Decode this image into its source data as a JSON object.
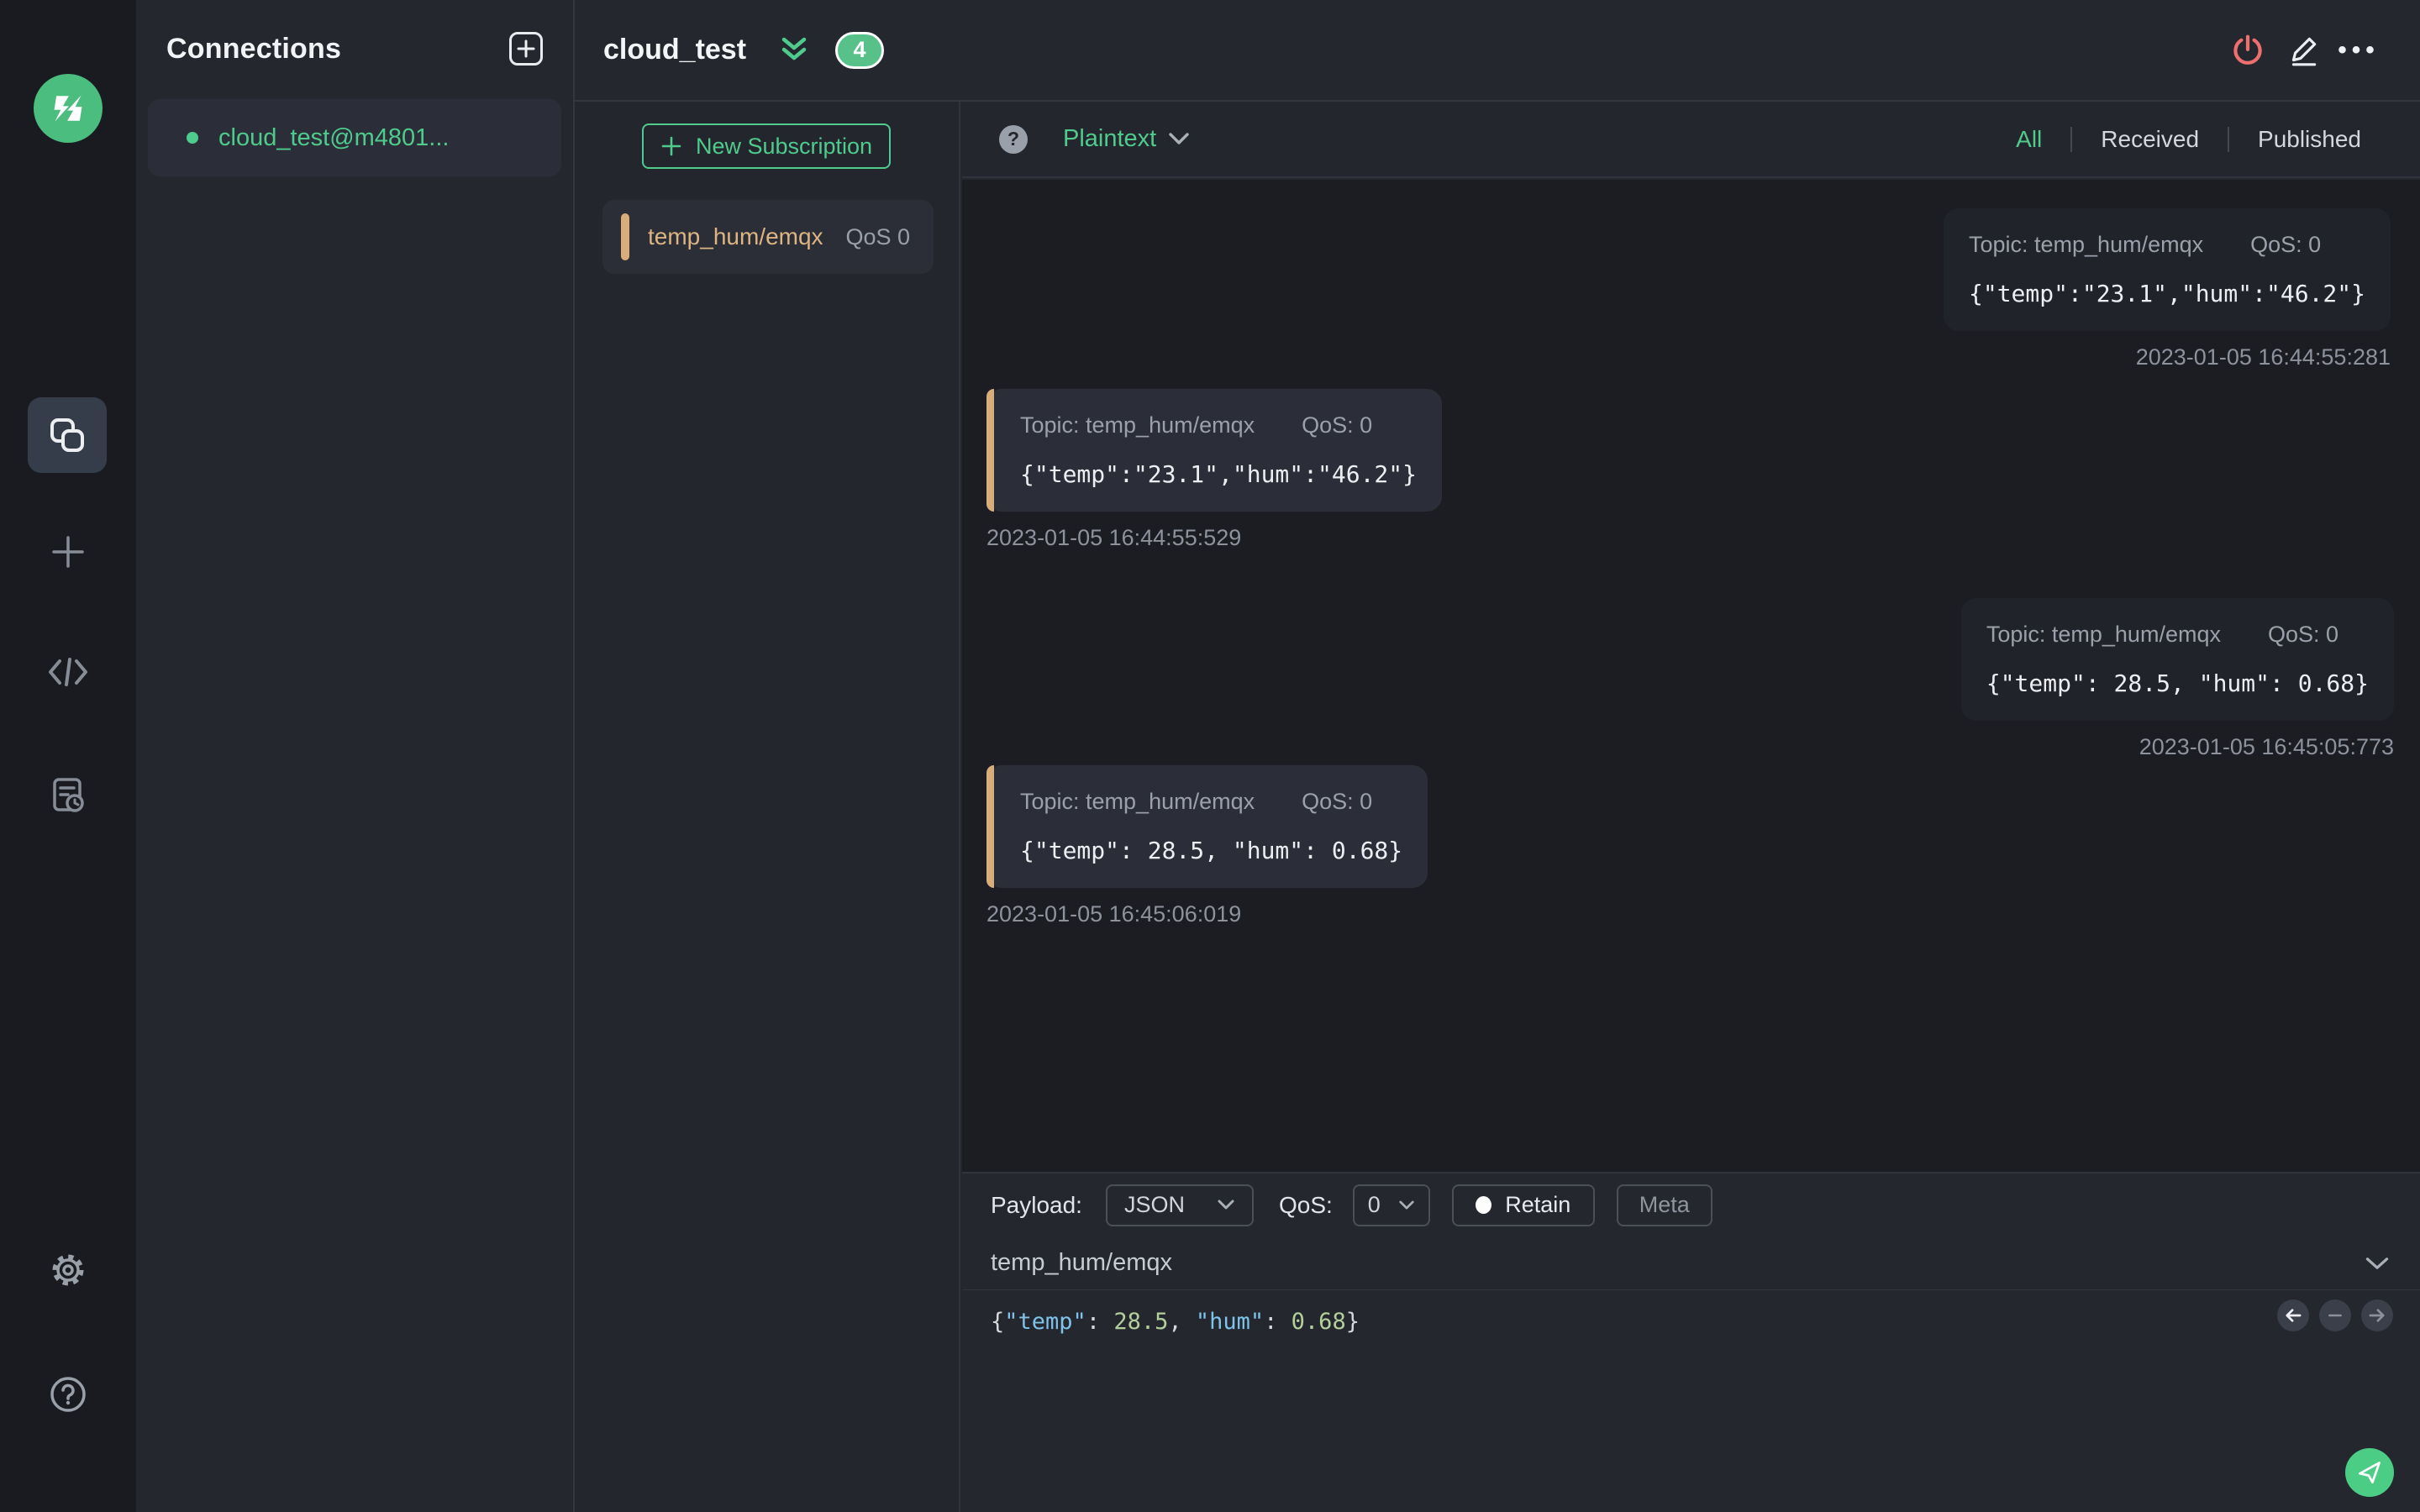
{
  "colors": {
    "accent_green": "#4ecb8d",
    "danger_red": "#ee6f6f",
    "topic_tan": "#d8ad79",
    "syntax_key_blue": "#7ec3ea",
    "syntax_num_green": "#b3cf9b"
  },
  "connections_panel": {
    "title": "Connections",
    "items": [
      {
        "name": "cloud_test@m4801..."
      }
    ]
  },
  "header": {
    "title": "cloud_test",
    "badge": "4"
  },
  "subscriptions": {
    "new_label": "New Subscription",
    "items": [
      {
        "topic": "temp_hum/emqx",
        "qos": "QoS 0"
      }
    ]
  },
  "toolbar": {
    "format_label": "Plaintext",
    "tabs": [
      "All",
      "Received",
      "Published"
    ]
  },
  "messages": [
    {
      "direction": "published",
      "topic_label": "Topic: temp_hum/emqx",
      "qos_label": "QoS: 0",
      "payload": "{\"temp\":\"23.1\",\"hum\":\"46.2\"}",
      "time": "2023-01-05 16:44:55:281"
    },
    {
      "direction": "received",
      "topic_label": "Topic: temp_hum/emqx",
      "qos_label": "QoS: 0",
      "payload": "{\"temp\":\"23.1\",\"hum\":\"46.2\"}",
      "time": "2023-01-05 16:44:55:529"
    },
    {
      "direction": "published",
      "topic_label": "Topic: temp_hum/emqx",
      "qos_label": "QoS: 0",
      "payload": "{\"temp\": 28.5, \"hum\": 0.68}",
      "time": "2023-01-05 16:45:05:773"
    },
    {
      "direction": "received",
      "topic_label": "Topic: temp_hum/emqx",
      "qos_label": "QoS: 0",
      "payload": "{\"temp\": 28.5, \"hum\": 0.68}",
      "time": "2023-01-05 16:45:06:019"
    }
  ],
  "publish": {
    "payload_label": "Payload:",
    "format_value": "JSON",
    "qos_label": "QoS:",
    "qos_value": "0",
    "retain_label": "Retain",
    "meta_label": "Meta",
    "topic_value": "temp_hum/emqx",
    "tokens": [
      {
        "text": "{"
      },
      {
        "text": "\"temp\""
      },
      {
        "text": ": "
      },
      {
        "text": "28.5"
      },
      {
        "text": ", "
      },
      {
        "text": "\"hum\""
      },
      {
        "text": ": "
      },
      {
        "text": "0.68"
      },
      {
        "text": "}"
      }
    ]
  }
}
